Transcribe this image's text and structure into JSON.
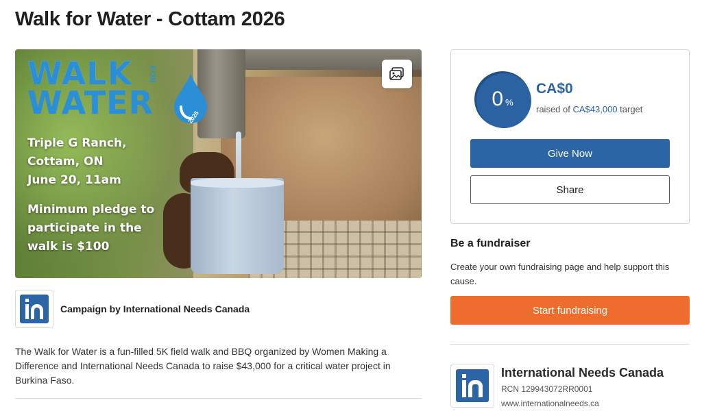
{
  "page": {
    "title": "Walk for Water - Cottam 2026"
  },
  "hero": {
    "logo_line1": "WALK",
    "logo_for": "FOR",
    "logo_line2": "WATER",
    "logo_year": "2026",
    "location_lines": [
      "Triple G Ranch,",
      "Cottam, ON",
      "June 20, 11am"
    ],
    "pledge_lines": [
      "Minimum pledge to",
      "participate in the",
      "walk is $100"
    ],
    "gallery_icon": "image-gallery-icon"
  },
  "campaign": {
    "by_label": "Campaign by International Needs Canada",
    "description": "The Walk for Water is a fun-filled 5K field walk and BBQ organized by Women Making a Difference and International Needs Canada to raise $43,000 for a critical water project in Burkina Faso."
  },
  "donation": {
    "percent": "0",
    "percent_symbol": "%",
    "progress_fraction": 0,
    "raised_amount": "CA$0",
    "raised_prefix": "raised of ",
    "target_amount": "CA$43,000",
    "target_suffix": " target",
    "give_label": "Give Now",
    "share_label": "Share"
  },
  "fundraiser": {
    "heading": "Be a fundraiser",
    "text": "Create your own fundraising page and help support this cause.",
    "button_label": "Start fundraising"
  },
  "organization": {
    "name": "International Needs Canada",
    "rcn": "RCN 129943072RR0001",
    "url": "www.internationalneeds.ca"
  },
  "colors": {
    "primary": "#2b65a6",
    "accent": "#ee6c2d",
    "logo_blue": "#2a8fd6"
  }
}
